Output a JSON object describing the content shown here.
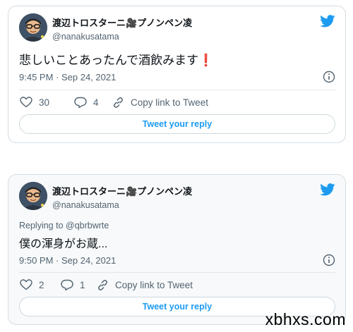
{
  "colors": {
    "accent": "#1d9bf0",
    "text": "#0f1419",
    "secondary": "#536471",
    "like_icon": "#536471"
  },
  "tweets": [
    {
      "author": {
        "display_name": "渡辺トロスターニ🎥プノンペン凌",
        "handle": "@nanakusatama"
      },
      "text": "悲しいことあったんで酒飲みます❗️",
      "timestamp": "9:45 PM · Sep 24, 2021",
      "likes": "30",
      "replies": "4",
      "copy_link_label": "Copy link to Tweet",
      "reply_button_label": "Tweet your reply"
    },
    {
      "author": {
        "display_name": "渡辺トロスターニ🎥プノンペン凌",
        "handle": "@nanakusatama"
      },
      "replying_to": "Replying to @qbrbwrte",
      "text": "僕の渾身がお蔵...",
      "timestamp": "9:50 PM · Sep 24, 2021",
      "likes": "2",
      "replies": "1",
      "copy_link_label": "Copy link to Tweet",
      "reply_button_label": "Tweet your reply"
    }
  ],
  "watermark": "xbhxs.com"
}
